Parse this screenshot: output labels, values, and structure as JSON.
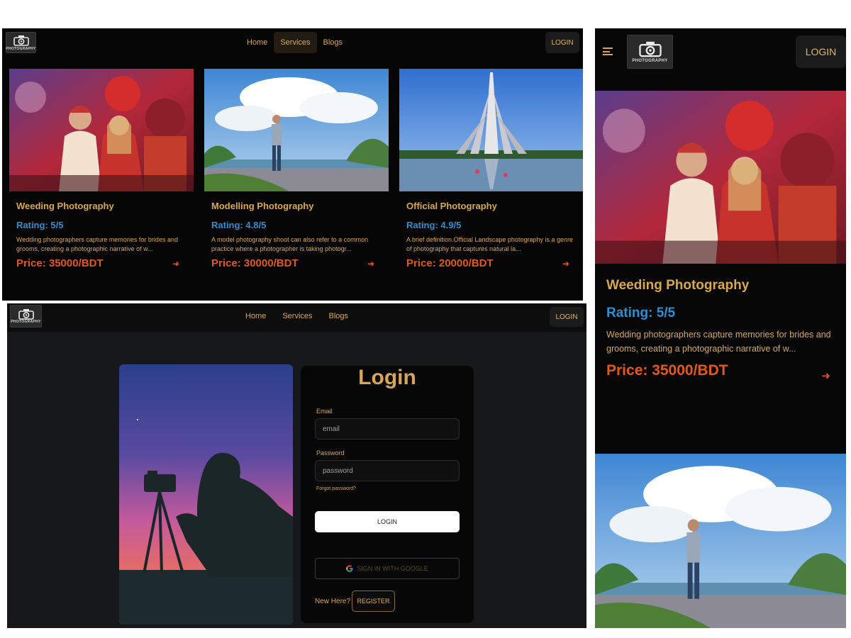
{
  "brand": {
    "logo_text": "PHOTOGRAPHY"
  },
  "nav": {
    "home": "Home",
    "services": "Services",
    "blogs": "Blogs",
    "login": "LOGIN"
  },
  "services": [
    {
      "title": "Weeding Photography",
      "rating": "Rating: 5/5",
      "desc": "Wedding photographers capture memories for brides and grooms, creating a photographic narrative of w...",
      "price": "Price: 35000/BDT"
    },
    {
      "title": "Modelling Photography",
      "rating": "Rating: 4.8/5",
      "desc": "A model photography shoot can also refer to a common practice where a photographer is taking photogr...",
      "price": "Price: 30000/BDT"
    },
    {
      "title": "Official Photography",
      "rating": "Rating: 4.9/5",
      "desc": "A brief definition.Official Landscape photography is a genre of photography that captures natural la...",
      "price": "Price: 20000/BDT"
    }
  ],
  "login_form": {
    "title": "Login",
    "email_label": "Email",
    "email_placeholder": "email",
    "password_label": "Password",
    "password_placeholder": "password",
    "forgot": "Forgot password?",
    "login_button": "LOGIN",
    "google_button": "SIGN IN WITH GOOGLE",
    "new_here": "New Here?",
    "register_button": "REGISTER"
  },
  "colors": {
    "gold": "#d9a84e",
    "rating_blue": "#2b8fd6",
    "price_orange": "#e2581c",
    "background": "#060606"
  }
}
